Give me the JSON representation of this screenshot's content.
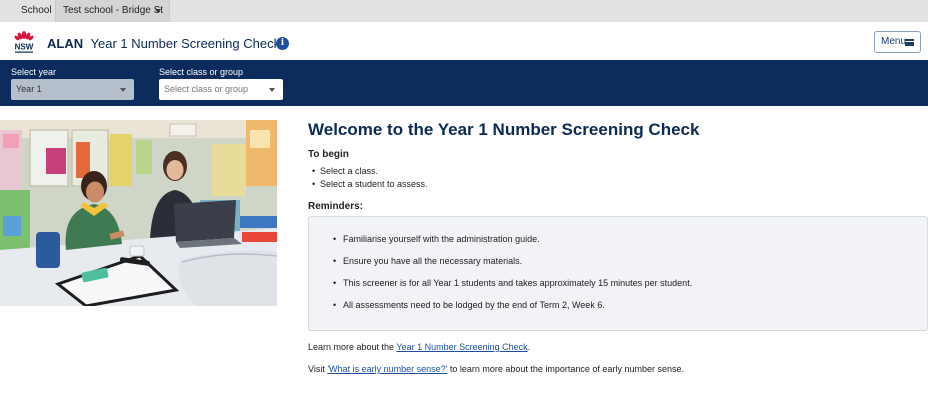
{
  "topbar": {
    "school_label": "School",
    "school_value": "Test school - Bridge St"
  },
  "header": {
    "logo_text": "NSW",
    "app_short": "ALAN",
    "app_title": "Year 1 Number Screening Check",
    "info_glyph": "i",
    "menu_label": "Menu"
  },
  "filters": {
    "year_label": "Select year",
    "year_value": "Year 1",
    "class_label": "Select class or group",
    "class_placeholder": "Select class or group"
  },
  "main": {
    "heading": "Welcome to the Year 1 Number Screening Check",
    "to_begin_title": "To begin",
    "to_begin_items": [
      "Select a class.",
      "Select a student to assess."
    ],
    "reminders_title": "Reminders:",
    "reminders": [
      "Familiarise yourself with the administration guide.",
      "Ensure you have all the necessary materials.",
      "This screener is for all Year 1 students and takes approximately 15 minutes per student.",
      "All assessments need to be lodged by the end of Term 2, Week 6."
    ],
    "learn_prefix": "Learn more about the ",
    "learn_link": "Year 1 Number Screening Check",
    "learn_suffix": ".",
    "visit_prefix": "Visit ",
    "visit_link": "'What is early number sense?'",
    "visit_suffix": " to learn more about the importance of early number sense."
  },
  "colors": {
    "navy": "#0b2c5c",
    "title_navy": "#0d2a55",
    "link_blue": "#1d4f9e",
    "nsw_red": "#d7153a"
  },
  "icons": {
    "school_dropdown": "chevron-down-icon",
    "info": "info-icon",
    "menu": "hamburger-icon",
    "logo": "nsw-waratah-logo"
  }
}
